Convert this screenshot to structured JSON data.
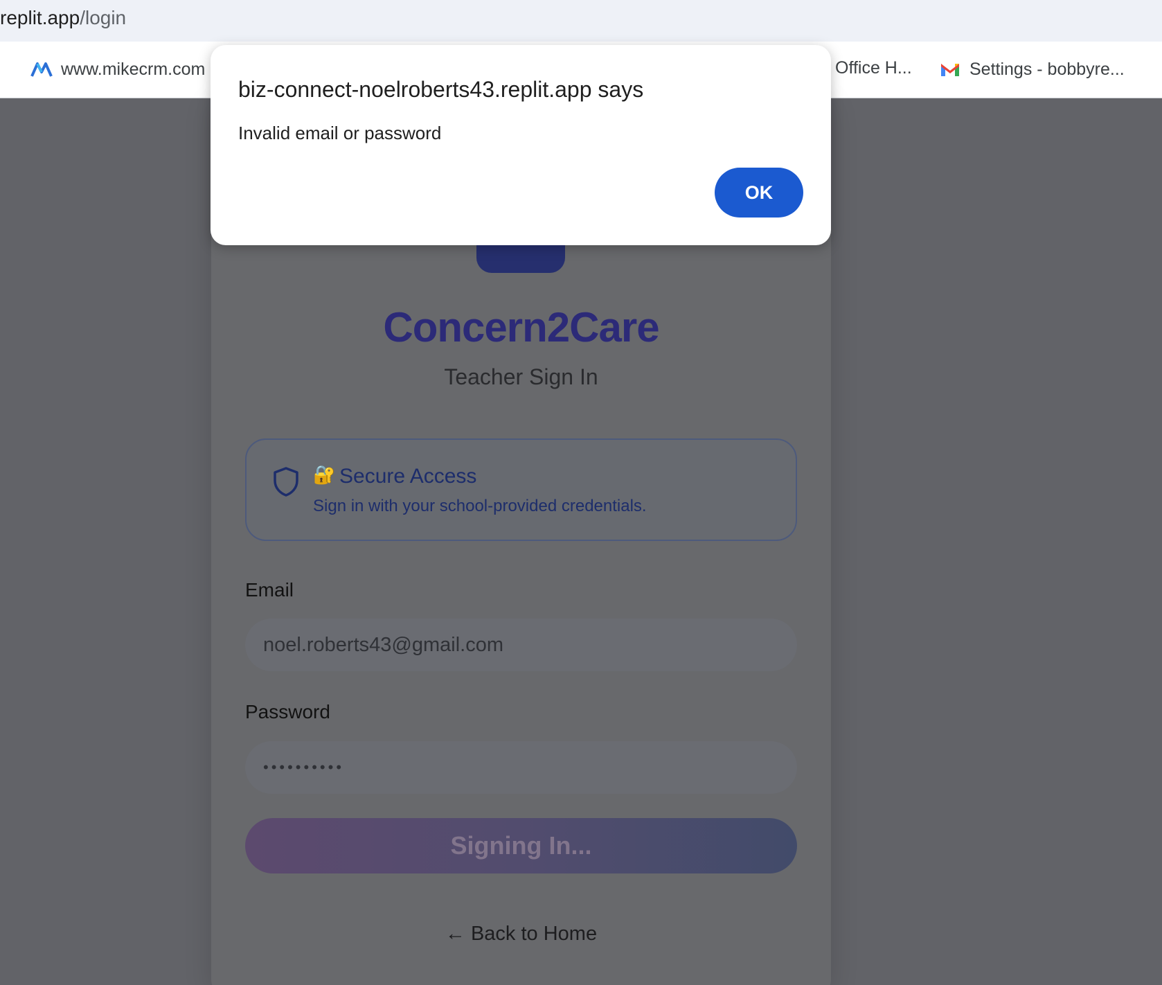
{
  "browser": {
    "url_domain": "replit.app",
    "url_path": "/login",
    "bookmarks": [
      {
        "label": "www.mikecrm.com",
        "icon": "mikecrm-icon"
      },
      {
        "label": "Office H...",
        "icon": ""
      },
      {
        "label": "Settings - bobbyre...",
        "icon": "gmail-icon"
      }
    ]
  },
  "dialog": {
    "title": "biz-connect-noelroberts43.replit.app says",
    "message": "Invalid email or password",
    "ok_label": "OK"
  },
  "login": {
    "brand": "Concern2Care",
    "subtitle": "Teacher Sign In",
    "secure_icon": "🔐",
    "secure_title": "Secure Access",
    "secure_desc": "Sign in with your school-provided credentials.",
    "email_label": "Email",
    "email_value": "noel.roberts43@gmail.com",
    "password_label": "Password",
    "password_value": "••••••••••",
    "submit_label": "Signing In...",
    "back_label": "← Back to Home"
  },
  "colors": {
    "brand": "#2c2a78",
    "ok_button": "#1b5ad0",
    "overlay": "#65666b"
  }
}
